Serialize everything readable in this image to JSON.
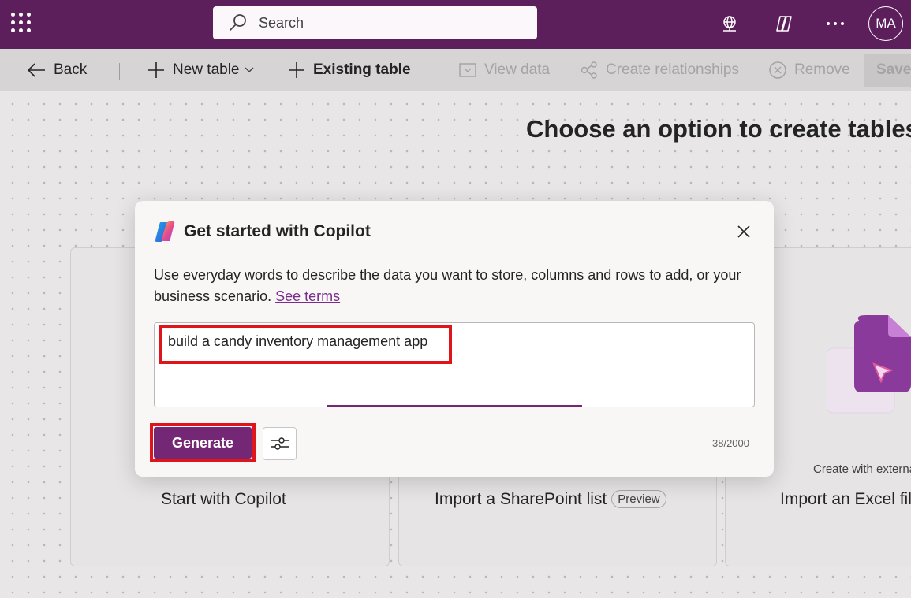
{
  "header": {
    "search_placeholder": "Search",
    "avatar_initials": "MA",
    "icons": [
      "waffle-icon",
      "environment-icon",
      "copilot-icon",
      "more-icon"
    ]
  },
  "commandbar": {
    "back_label": "Back",
    "new_table_label": "New table",
    "existing_table_label": "Existing table",
    "view_data_label": "View data",
    "create_relationships_label": "Create relationships",
    "remove_label": "Remove",
    "save_label": "Save"
  },
  "main": {
    "heading": "Choose an option to create tables",
    "cards": [
      {
        "title": "Start with Copilot"
      },
      {
        "title": "Import a SharePoint list",
        "badge": "Preview"
      },
      {
        "title": "Import an Excel file",
        "subtitle": "Create with external data"
      }
    ]
  },
  "dialog": {
    "title": "Get started with Copilot",
    "description": "Use everyday words to describe the data you want to store, columns and rows to add, or your business scenario.",
    "terms_link": "See terms",
    "prompt_value": "build a candy inventory management app",
    "generate_label": "Generate",
    "char_count": "38/2000"
  },
  "colors": {
    "header_bg": "#5c1f5c",
    "accent": "#742774",
    "highlight": "#e0141b"
  }
}
